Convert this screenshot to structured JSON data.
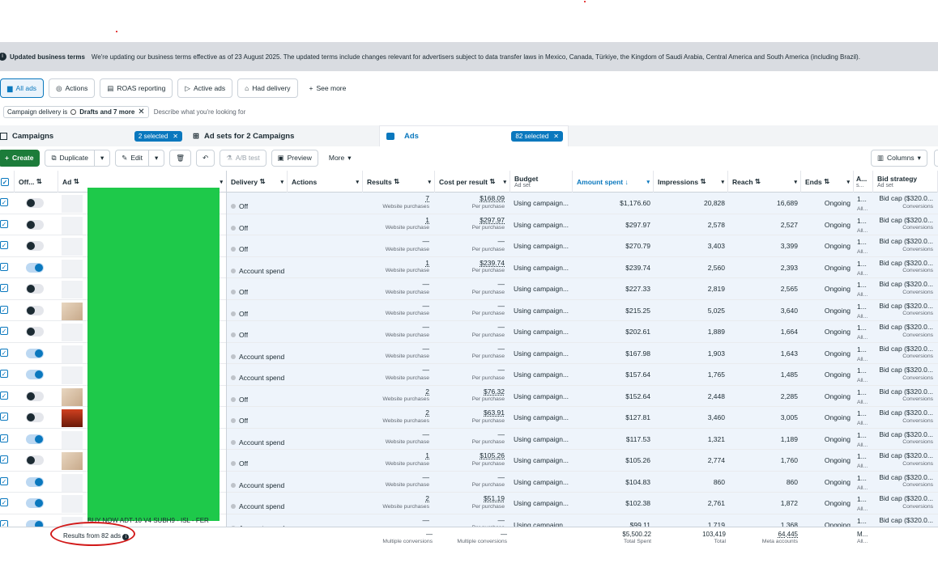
{
  "banner": {
    "title": "Updated business terms",
    "text": "We're updating our business terms effective as of 23 August 2025. The updated terms include changes relevant for advertisers subject to data transfer laws in Mexico, Canada, Türkiye, the Kingdom of Saudi Arabia, Central America and South America (including Brazil)."
  },
  "views": [
    {
      "label": "All ads",
      "icon": "folder-icon"
    },
    {
      "label": "Actions",
      "icon": "actions-icon"
    },
    {
      "label": "ROAS reporting",
      "icon": "report-icon"
    },
    {
      "label": "Active ads",
      "icon": "play-icon"
    },
    {
      "label": "Had delivery",
      "icon": "delivery-icon"
    },
    {
      "label": "See more",
      "icon": "plus-icon"
    }
  ],
  "filter": {
    "chip_prefix": "Campaign delivery is",
    "chip_bold": "Drafts and 7 more",
    "placeholder": "Describe what you're looking for"
  },
  "levels": {
    "campaigns": "Campaigns",
    "campaigns_selected": "2 selected",
    "adsets": "Ad sets for 2 Campaigns",
    "ads": "Ads",
    "ads_selected": "82 selected"
  },
  "toolbar": {
    "create": "Create",
    "duplicate": "Duplicate",
    "edit": "Edit",
    "ab_test": "A/B test",
    "preview": "Preview",
    "more": "More",
    "columns": "Columns"
  },
  "headers": {
    "off": "Off...",
    "ad": "Ad",
    "delivery": "Delivery",
    "actions": "Actions",
    "results": "Results",
    "cpr": "Cost per result",
    "budget": "Budget",
    "budget_sub": "Ad set",
    "amount": "Amount spent",
    "impressions": "Impressions",
    "reach": "Reach",
    "ends": "Ends",
    "attr": "A...",
    "attr_sub": "s...",
    "bid": "Bid strategy",
    "bid_sub": "Ad set"
  },
  "rows": [
    {
      "on": false,
      "thumb": "blank",
      "delivery": "Off",
      "results": "7",
      "results_label": "Website purchases",
      "cpr": "$168.09",
      "budget": "Using campaign...",
      "amount": "$1,176.60",
      "impr": "20,828",
      "reach": "16,689",
      "ends": "Ongoing",
      "attr": "1...",
      "attr2": "All...",
      "bid": "Bid cap ($320.0...",
      "bid_sub": "Conversions"
    },
    {
      "on": false,
      "thumb": "blank",
      "delivery": "Off",
      "results": "1",
      "results_label": "Website purchase",
      "cpr": "$297.97",
      "budget": "Using campaign...",
      "amount": "$297.97",
      "impr": "2,578",
      "reach": "2,527",
      "ends": "Ongoing",
      "attr": "1...",
      "attr2": "All...",
      "bid": "Bid cap ($320.0...",
      "bid_sub": "Conversions"
    },
    {
      "on": false,
      "thumb": "blank",
      "delivery": "Off",
      "results": "—",
      "results_label": "Website purchase",
      "cpr": "—",
      "budget": "Using campaign...",
      "amount": "$270.79",
      "impr": "3,403",
      "reach": "3,399",
      "ends": "Ongoing",
      "attr": "1...",
      "attr2": "All...",
      "bid": "Bid cap ($320.0...",
      "bid_sub": "Conversions"
    },
    {
      "on": true,
      "thumb": "blank",
      "delivery": "Account spend",
      "results": "1",
      "results_label": "Website purchase",
      "cpr": "$239.74",
      "budget": "Using campaign...",
      "amount": "$239.74",
      "impr": "2,560",
      "reach": "2,393",
      "ends": "Ongoing",
      "attr": "1...",
      "attr2": "All...",
      "bid": "Bid cap ($320.0...",
      "bid_sub": "Conversions"
    },
    {
      "on": false,
      "thumb": "blank",
      "delivery": "Off",
      "results": "—",
      "results_label": "Website purchase",
      "cpr": "—",
      "budget": "Using campaign...",
      "amount": "$227.33",
      "impr": "2,819",
      "reach": "2,565",
      "ends": "Ongoing",
      "attr": "1...",
      "attr2": "All...",
      "bid": "Bid cap ($320.0...",
      "bid_sub": "Conversions"
    },
    {
      "on": false,
      "thumb": "img",
      "delivery": "Off",
      "results": "—",
      "results_label": "Website purchase",
      "cpr": "—",
      "budget": "Using campaign...",
      "amount": "$215.25",
      "impr": "5,025",
      "reach": "3,640",
      "ends": "Ongoing",
      "attr": "1...",
      "attr2": "All...",
      "bid": "Bid cap ($320.0...",
      "bid_sub": "Conversions"
    },
    {
      "on": false,
      "thumb": "blank",
      "delivery": "Off",
      "results": "—",
      "results_label": "Website purchase",
      "cpr": "—",
      "budget": "Using campaign...",
      "amount": "$202.61",
      "impr": "1,889",
      "reach": "1,664",
      "ends": "Ongoing",
      "attr": "1...",
      "attr2": "All...",
      "bid": "Bid cap ($320.0...",
      "bid_sub": "Conversions"
    },
    {
      "on": true,
      "thumb": "blank",
      "delivery": "Account spend",
      "results": "—",
      "results_label": "Website purchase",
      "cpr": "—",
      "budget": "Using campaign...",
      "amount": "$167.98",
      "impr": "1,903",
      "reach": "1,643",
      "ends": "Ongoing",
      "attr": "1...",
      "attr2": "All...",
      "bid": "Bid cap ($320.0...",
      "bid_sub": "Conversions"
    },
    {
      "on": true,
      "thumb": "blank",
      "delivery": "Account spend",
      "results": "—",
      "results_label": "Website purchase",
      "cpr": "—",
      "budget": "Using campaign...",
      "amount": "$157.64",
      "impr": "1,765",
      "reach": "1,485",
      "ends": "Ongoing",
      "attr": "1...",
      "attr2": "All...",
      "bid": "Bid cap ($320.0...",
      "bid_sub": "Conversions"
    },
    {
      "on": false,
      "thumb": "img",
      "delivery": "Off",
      "results": "2",
      "results_label": "Website purchases",
      "cpr": "$76.32",
      "budget": "Using campaign...",
      "amount": "$152.64",
      "impr": "2,448",
      "reach": "2,285",
      "ends": "Ongoing",
      "attr": "1...",
      "attr2": "All...",
      "bid": "Bid cap ($320.0...",
      "bid_sub": "Conversions"
    },
    {
      "on": false,
      "thumb": "dark",
      "delivery": "Off",
      "results": "2",
      "results_label": "Website purchases",
      "cpr": "$63.91",
      "budget": "Using campaign...",
      "amount": "$127.81",
      "impr": "3,460",
      "reach": "3,005",
      "ends": "Ongoing",
      "attr": "1...",
      "attr2": "All...",
      "bid": "Bid cap ($320.0...",
      "bid_sub": "Conversions"
    },
    {
      "on": true,
      "thumb": "blank",
      "delivery": "Account spend",
      "results": "—",
      "results_label": "Website purchase",
      "cpr": "—",
      "budget": "Using campaign...",
      "amount": "$117.53",
      "impr": "1,321",
      "reach": "1,189",
      "ends": "Ongoing",
      "attr": "1...",
      "attr2": "All...",
      "bid": "Bid cap ($320.0...",
      "bid_sub": "Conversions"
    },
    {
      "on": false,
      "thumb": "img",
      "delivery": "Off",
      "results": "1",
      "results_label": "Website purchase",
      "cpr": "$105.26",
      "budget": "Using campaign...",
      "amount": "$105.26",
      "impr": "2,774",
      "reach": "1,760",
      "ends": "Ongoing",
      "attr": "1...",
      "attr2": "All...",
      "bid": "Bid cap ($320.0...",
      "bid_sub": "Conversions"
    },
    {
      "on": true,
      "thumb": "blank",
      "delivery": "Account spend",
      "results": "—",
      "results_label": "Website purchase",
      "cpr": "—",
      "budget": "Using campaign...",
      "amount": "$104.83",
      "impr": "860",
      "reach": "860",
      "ends": "Ongoing",
      "attr": "1...",
      "attr2": "All...",
      "bid": "Bid cap ($320.0...",
      "bid_sub": "Conversions"
    },
    {
      "on": true,
      "thumb": "blank",
      "delivery": "Account spend",
      "results": "2",
      "results_label": "Website purchases",
      "cpr": "$51.19",
      "budget": "Using campaign...",
      "amount": "$102.38",
      "impr": "2,761",
      "reach": "1,872",
      "ends": "Ongoing",
      "attr": "1...",
      "attr2": "All...",
      "bid": "Bid cap ($320.0...",
      "bid_sub": "Conversions"
    },
    {
      "on": true,
      "thumb": "blank",
      "delivery": "Account spend",
      "results": "—",
      "results_label": "",
      "cpr": "—",
      "budget": "Using campaign...",
      "amount": "$99.11",
      "impr": "1,719",
      "reach": "1,368",
      "ends": "Ongoing",
      "attr": "1...",
      "attr2": "",
      "bid": "Bid cap ($320.0...",
      "bid_sub": ""
    }
  ],
  "last_row_name": "BUY NOW ADT-10 V4 SUBH9 - ISL - FER",
  "footer": {
    "results_from": "Results from 82 ads",
    "results": "—",
    "results_label": "Multiple conversions",
    "cpr": "—",
    "cpr_label": "Multiple conversions",
    "amount": "$5,500.22",
    "amount_label": "Total Spent",
    "impr": "103,419",
    "impr_label": "Total",
    "reach": "64,445",
    "reach_label": "Meta accounts",
    "attr": "M...",
    "attr2": "All..."
  },
  "colors": {
    "accent": "#0a78be",
    "create": "#1c7c3a",
    "redacted": "#1ec94a",
    "annotation": "#d21a1a"
  }
}
